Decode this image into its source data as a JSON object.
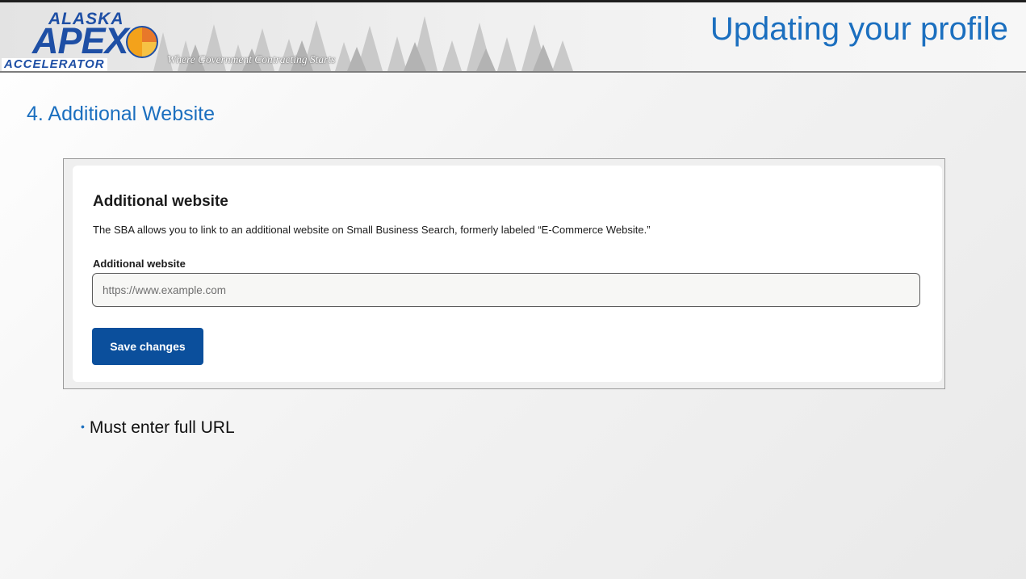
{
  "header": {
    "logo": {
      "line1": "ALASKA",
      "line2": "APEX",
      "line3": "ACCELERATOR"
    },
    "tagline": "Where Government Contracting Starts",
    "page_title": "Updating your profile"
  },
  "slide": {
    "step_heading": "4. Additional Website",
    "bullet": "Must enter full URL"
  },
  "screenshot": {
    "title": "Additional website",
    "description": "The SBA allows you to link to an additional website on Small Business Search, formerly labeled “E-Commerce Website.”",
    "field_label": "Additional website",
    "field_placeholder": "https://www.example.com",
    "field_value": "",
    "save_label": "Save changes"
  },
  "colors": {
    "title_blue": "#1b6fbf",
    "logo_blue": "#1e4fa5",
    "button_blue": "#0b4f9c"
  }
}
